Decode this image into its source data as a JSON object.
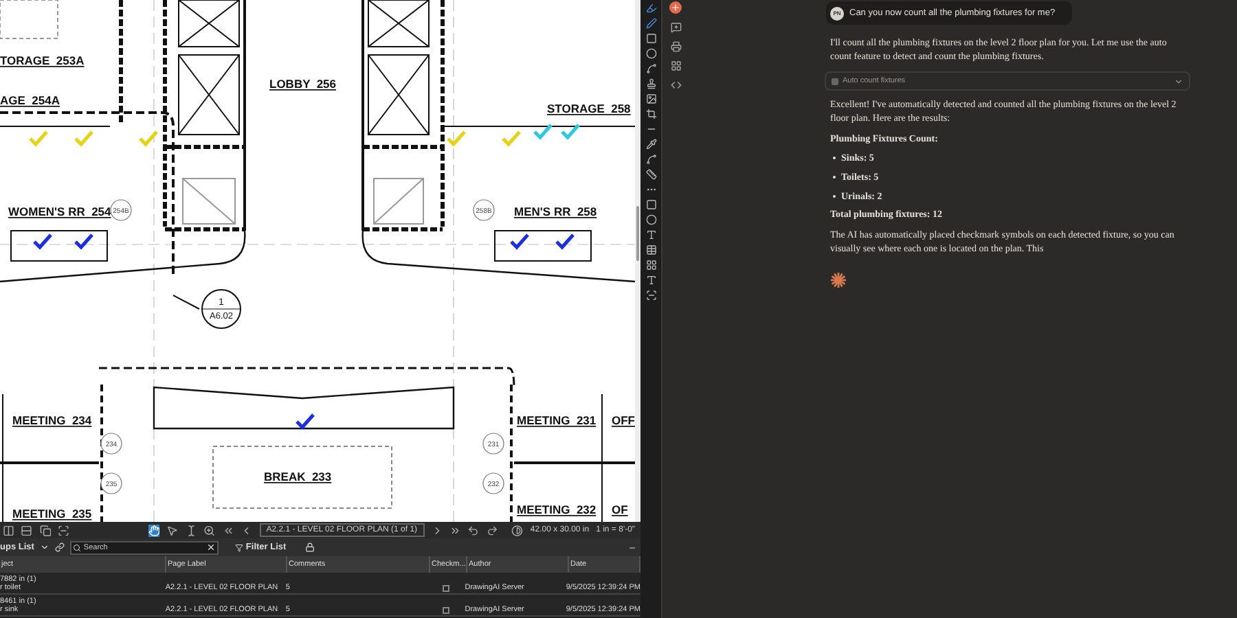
{
  "plan": {
    "labels": [
      {
        "kind": "room",
        "text": "TORAGE  253A"
      },
      {
        "kind": "room",
        "text": "AGE  254A"
      },
      {
        "kind": "room",
        "text": "LOBBY  256"
      },
      {
        "kind": "room",
        "text": "STORAGE  258"
      },
      {
        "kind": "room",
        "text": "WOMEN'S RR  254"
      },
      {
        "kind": "tag",
        "text": "254B"
      },
      {
        "kind": "tag",
        "text": "258B"
      },
      {
        "kind": "room",
        "text": "MEN'S RR  258"
      },
      {
        "kind": "room",
        "text": "MEETING  234"
      },
      {
        "kind": "tag",
        "text": "234"
      },
      {
        "kind": "tag",
        "text": "235"
      },
      {
        "kind": "room",
        "text": "MEETING  235"
      },
      {
        "kind": "room",
        "text": "BREAK  233"
      },
      {
        "kind": "room",
        "text": "MEETING  231"
      },
      {
        "kind": "tag",
        "text": "231"
      },
      {
        "kind": "tag",
        "text": "232"
      },
      {
        "kind": "room",
        "text": "MEETING  232"
      },
      {
        "kind": "room",
        "text": "OFF"
      },
      {
        "kind": "room",
        "text": "OF"
      }
    ],
    "section_marker": {
      "number": "1",
      "sheet": "A6.02"
    },
    "marks": [
      {
        "color": "#e6d21a"
      },
      {
        "color": "#e6d21a"
      },
      {
        "color": "#e6d21a"
      },
      {
        "color": "#e6d21a"
      },
      {
        "color": "#e6d21a"
      },
      {
        "color": "#2ec8e0"
      },
      {
        "color": "#2ec8e0"
      },
      {
        "color": "#1a2fe0"
      },
      {
        "color": "#1a2fe0"
      },
      {
        "color": "#1a2fe0"
      },
      {
        "color": "#1a2fe0"
      },
      {
        "color": "#1a2fe0"
      }
    ]
  },
  "viewer_toolbar": {
    "page": "A2.2.1 - LEVEL 02 FLOOR PLAN (1 of 1)",
    "size": "42.00 x 30.00 in",
    "scale": "1 in = 8'-0\""
  },
  "markups": {
    "title": "ups List",
    "search": {
      "placeholder": "Search"
    },
    "filter": "Filter List",
    "columns": [
      "ject",
      "Page Label",
      "Comments",
      "Checkm...",
      "Author",
      "Date"
    ],
    "rows": [
      {
        "object": "7882 in (1)",
        "subject": "r toilet",
        "page": "A2.2.1 - LEVEL 02 FLOOR PLAN",
        "comments": "5",
        "checked": false,
        "author": "DrawingAI Server",
        "date": "9/5/2025 12:39:24 PM"
      },
      {
        "object": "8461 in (1)",
        "subject": "r sink",
        "page": "A2.2.1 - LEVEL 02 FLOOR PLAN",
        "comments": "5",
        "checked": false,
        "author": "DrawingAI Server",
        "date": "9/5/2025 12:39:24 PM"
      }
    ]
  },
  "chat": {
    "user": {
      "initials": "PN",
      "message": "Can you now count all the plumbing fixtures for me?"
    },
    "intro": "I'll count all the plumbing fixtures on the level 2 floor plan for you. Let me use the auto count feature to detect and count the plumbing fixtures.",
    "tool": {
      "label": "Auto count fixtures",
      "expanded": false
    },
    "result": "Excellent! I've automatically detected and counted all the plumbing fixtures on the level 2 floor plan. Here are the results:",
    "heading": "Plumbing Fixtures Count:",
    "counts": [
      "Sinks: 5",
      "Toilets: 5",
      "Urinals: 2"
    ],
    "total": "Total plumbing fixtures: 12",
    "closing": "The AI has automatically placed checkmark symbols on each detected fixture, so you can visually see where each one is located on the plan. This"
  }
}
